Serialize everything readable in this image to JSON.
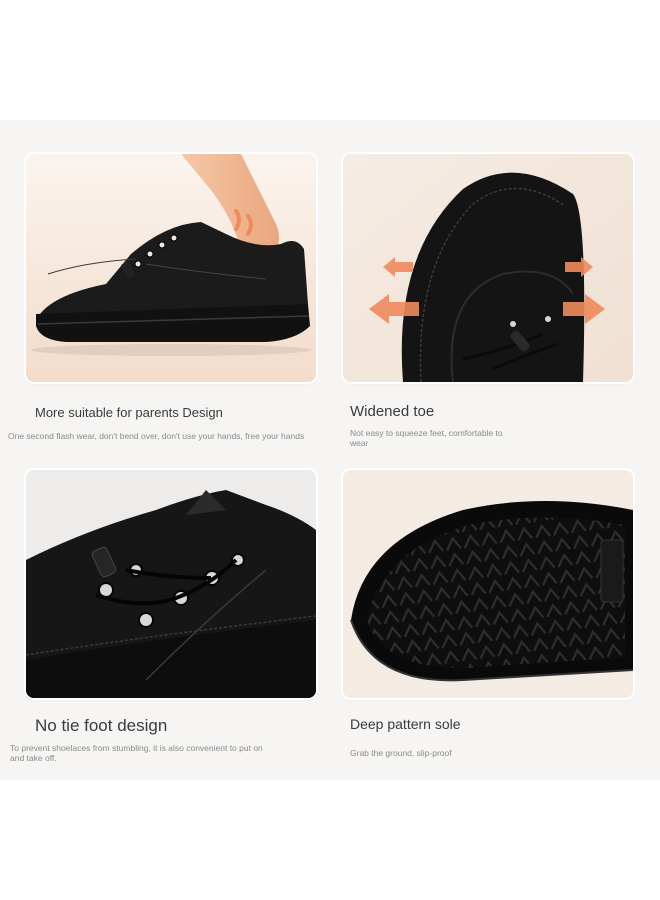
{
  "features": [
    {
      "title": "More suitable for parents Design",
      "description": "One second flash wear, don't bend over, don't use your hands, free your hands",
      "image": "heel-step-in-shoe"
    },
    {
      "title": "Widened toe",
      "description": "Not easy to squeeze feet, comfortable to wear",
      "image": "widened-toe-with-arrows"
    },
    {
      "title": "No tie foot design",
      "description": "To prevent shoelaces from stumbling, it is also convenient to put on and take off.",
      "image": "elastic-lace-toggle"
    },
    {
      "title": "Deep pattern sole",
      "description": "Grab the ground, slip-proof",
      "image": "tread-sole"
    }
  ],
  "colors": {
    "panel": "#f6f5f3",
    "shoe": "#1b1b1b",
    "arrow": "#f08a5d",
    "skin": "#f2b98f"
  }
}
